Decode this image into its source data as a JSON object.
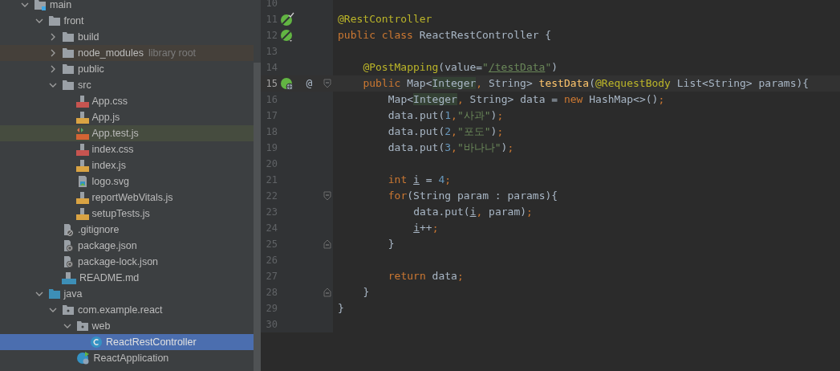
{
  "project_tree": [
    {
      "label": "main",
      "kind": "module-folder",
      "expanded": true,
      "selected": false,
      "children": [
        {
          "label": "front",
          "kind": "folder",
          "expanded": true,
          "selected": false,
          "children": [
            {
              "label": "build",
              "kind": "folder",
              "expanded": false,
              "selected": false
            },
            {
              "label": "node_modules",
              "hint": "library root",
              "kind": "folder",
              "expanded": false,
              "selected": false,
              "highlight": {
                "kind": "library"
              }
            },
            {
              "label": "public",
              "kind": "folder",
              "expanded": false,
              "selected": false
            },
            {
              "label": "src",
              "kind": "folder",
              "expanded": true,
              "selected": false,
              "children": [
                {
                  "label": "App.css",
                  "kind": "css",
                  "selected": false
                },
                {
                  "label": "App.js",
                  "kind": "js",
                  "selected": false
                },
                {
                  "label": "App.test.js",
                  "kind": "js-test",
                  "selected": false,
                  "highlight": {
                    "kind": "test"
                  }
                },
                {
                  "label": "index.css",
                  "kind": "css",
                  "selected": false
                },
                {
                  "label": "index.js",
                  "kind": "js",
                  "selected": false
                },
                {
                  "label": "logo.svg",
                  "kind": "image",
                  "selected": false
                },
                {
                  "label": "reportWebVitals.js",
                  "kind": "js",
                  "selected": false
                },
                {
                  "label": "setupTests.js",
                  "kind": "js",
                  "selected": false
                }
              ]
            },
            {
              "label": ".gitignore",
              "kind": "ignore",
              "selected": false
            },
            {
              "label": "package.json",
              "kind": "json",
              "selected": false
            },
            {
              "label": "package-lock.json",
              "kind": "json",
              "selected": false
            },
            {
              "label": "README.md",
              "kind": "md",
              "selected": false
            }
          ]
        },
        {
          "label": "java",
          "kind": "source-folder",
          "expanded": true,
          "selected": false,
          "children": [
            {
              "label": "com.example.react",
              "kind": "package",
              "expanded": true,
              "selected": false,
              "children": [
                {
                  "label": "web",
                  "kind": "package",
                  "expanded": true,
                  "selected": false,
                  "children": [
                    {
                      "label": "ReactRestController",
                      "kind": "class",
                      "selected": true
                    }
                  ]
                },
                {
                  "label": "ReactApplication",
                  "kind": "spring-class",
                  "selected": false
                }
              ]
            }
          ]
        }
      ]
    }
  ],
  "editor": {
    "lines": [
      {
        "number": "10",
        "current": false
      },
      {
        "number": "11",
        "current": false,
        "marker": {
          "kind": "bean-check"
        },
        "tokens": [
          {
            "text": "@RestController",
            "kind": "annotation"
          }
        ]
      },
      {
        "number": "12",
        "current": false,
        "marker": {
          "kind": "bean"
        },
        "tokens": [
          {
            "text": "public class ",
            "kind": "keyword"
          },
          {
            "text": "ReactRestController {",
            "kind": "plain"
          }
        ],
        "children": [
          {
            "number": "13",
            "current": false
          },
          {
            "number": "14",
            "current": false,
            "tokens": [
              {
                "text": "@PostMapping",
                "kind": "annotation"
              },
              {
                "text": "(value=",
                "kind": "plain"
              },
              {
                "text": "\"",
                "kind": "string"
              },
              {
                "text": "/testData",
                "kind": "link"
              },
              {
                "text": "\"",
                "kind": "string"
              },
              {
                "text": ")",
                "kind": "plain"
              }
            ]
          },
          {
            "number": "15",
            "current": true,
            "marker": {
              "kind": "globe"
            },
            "at": "@",
            "fold": {
              "kind": "start"
            },
            "tokens": [
              {
                "text": "public ",
                "kind": "keyword"
              },
              {
                "text": "Map<",
                "kind": "plain"
              },
              {
                "text": "Integer",
                "kind": "match"
              },
              {
                "text": ",",
                "kind": "keyword"
              },
              {
                "text": " String> ",
                "kind": "plain"
              },
              {
                "text": "testData",
                "kind": "method"
              },
              {
                "text": "(",
                "kind": "plain"
              },
              {
                "text": "@RequestBody",
                "kind": "annotation"
              },
              {
                "text": " List<String> params){",
                "kind": "plain"
              }
            ],
            "children": [
              {
                "number": "16",
                "current": false,
                "tokens": [
                  {
                    "text": "Map<",
                    "kind": "plain"
                  },
                  {
                    "text": "Integer",
                    "kind": "match"
                  },
                  {
                    "text": ",",
                    "kind": "keyword"
                  },
                  {
                    "text": " String> data = ",
                    "kind": "plain"
                  },
                  {
                    "text": "new ",
                    "kind": "keyword"
                  },
                  {
                    "text": "HashMap<>()",
                    "kind": "plain"
                  },
                  {
                    "text": ";",
                    "kind": "keyword"
                  }
                ]
              },
              {
                "number": "17",
                "current": false,
                "tokens": [
                  {
                    "text": "data.put(",
                    "kind": "plain"
                  },
                  {
                    "text": "1",
                    "kind": "number"
                  },
                  {
                    "text": ",",
                    "kind": "keyword"
                  },
                  {
                    "text": "\"사과\"",
                    "kind": "string"
                  },
                  {
                    "text": ")",
                    "kind": "plain"
                  },
                  {
                    "text": ";",
                    "kind": "keyword"
                  }
                ]
              },
              {
                "number": "18",
                "current": false,
                "tokens": [
                  {
                    "text": "data.put(",
                    "kind": "plain"
                  },
                  {
                    "text": "2",
                    "kind": "number"
                  },
                  {
                    "text": ",",
                    "kind": "keyword"
                  },
                  {
                    "text": "\"포도\"",
                    "kind": "string"
                  },
                  {
                    "text": ")",
                    "kind": "plain"
                  },
                  {
                    "text": ";",
                    "kind": "keyword"
                  }
                ]
              },
              {
                "number": "19",
                "current": false,
                "tokens": [
                  {
                    "text": "data.put(",
                    "kind": "plain"
                  },
                  {
                    "text": "3",
                    "kind": "number"
                  },
                  {
                    "text": ",",
                    "kind": "keyword"
                  },
                  {
                    "text": "\"바나나\"",
                    "kind": "string"
                  },
                  {
                    "text": ")",
                    "kind": "plain"
                  },
                  {
                    "text": ";",
                    "kind": "keyword"
                  }
                ]
              },
              {
                "number": "20",
                "current": false
              },
              {
                "number": "21",
                "current": false,
                "tokens": [
                  {
                    "text": "int ",
                    "kind": "keyword"
                  },
                  {
                    "text": "i",
                    "kind": "variable"
                  },
                  {
                    "text": " = ",
                    "kind": "plain"
                  },
                  {
                    "text": "4",
                    "kind": "number"
                  },
                  {
                    "text": ";",
                    "kind": "keyword"
                  }
                ]
              },
              {
                "number": "22",
                "current": false,
                "fold": {
                  "kind": "start"
                },
                "tokens": [
                  {
                    "text": "for",
                    "kind": "keyword"
                  },
                  {
                    "text": "(String param : params){",
                    "kind": "plain"
                  }
                ],
                "children": [
                  {
                    "number": "23",
                    "current": false,
                    "tokens": [
                      {
                        "text": "data.put(",
                        "kind": "plain"
                      },
                      {
                        "text": "i",
                        "kind": "variable"
                      },
                      {
                        "text": ",",
                        "kind": "keyword"
                      },
                      {
                        "text": " param)",
                        "kind": "plain"
                      },
                      {
                        "text": ";",
                        "kind": "keyword"
                      }
                    ]
                  },
                  {
                    "number": "24",
                    "current": false,
                    "tokens": [
                      {
                        "text": "i",
                        "kind": "variable"
                      },
                      {
                        "text": "++",
                        "kind": "plain"
                      },
                      {
                        "text": ";",
                        "kind": "keyword"
                      }
                    ]
                  }
                ]
              },
              {
                "number": "25",
                "current": false,
                "fold": {
                  "kind": "end"
                },
                "tokens": [
                  {
                    "text": "}",
                    "kind": "plain"
                  }
                ]
              },
              {
                "number": "26",
                "current": false
              },
              {
                "number": "27",
                "current": false,
                "tokens": [
                  {
                    "text": "return ",
                    "kind": "keyword"
                  },
                  {
                    "text": "data",
                    "kind": "plain"
                  },
                  {
                    "text": ";",
                    "kind": "keyword"
                  }
                ]
              }
            ]
          },
          {
            "number": "28",
            "current": false,
            "fold": {
              "kind": "end"
            },
            "tokens": [
              {
                "text": "}",
                "kind": "plain"
              }
            ]
          }
        ]
      },
      {
        "number": "29",
        "current": false,
        "tokens": [
          {
            "text": "}",
            "kind": "plain"
          }
        ]
      },
      {
        "number": "30",
        "current": false
      }
    ]
  }
}
